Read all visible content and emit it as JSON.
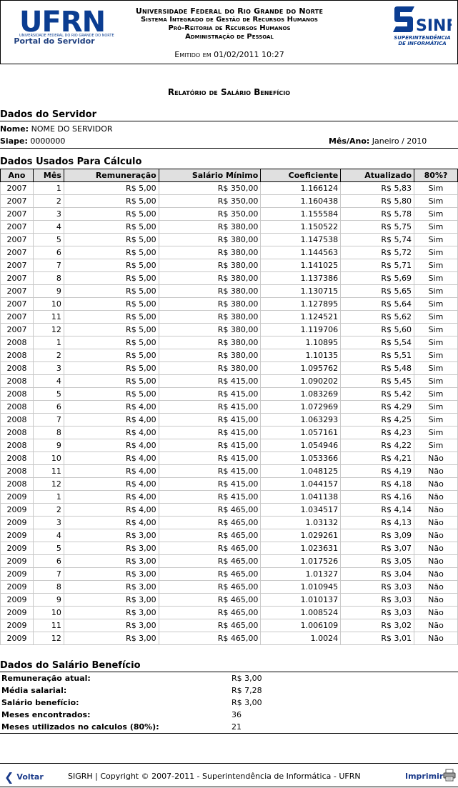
{
  "header": {
    "logo_text": "UFRN",
    "logo_subtext": "UNIVERSIDADE FEDERAL DO RIO GRANDE DO NORTE",
    "portal": "Portal do Servidor",
    "line1": "Universidade Federal do Rio Grande do Norte",
    "line2": "Sistema Integrado de Gestão de Recursos Humanos",
    "line3": "Pró-Reitoria de Recursos Humanos",
    "line4": "Administração de Pessoal",
    "emitted": "Emitido em 01/02/2011 10:27",
    "sinfo_logo": "SINFO",
    "sinfo_line1": "SUPERINTENDÊNCIA",
    "sinfo_line2": "DE INFORMÁTICA",
    "colors": {
      "brand_blue": "#0b3d91",
      "header_bg": "#e0e0e0"
    }
  },
  "report_title": "Relatório de Salário Benefício",
  "servidor": {
    "section_title": "Dados do Servidor",
    "nome_label": "Nome:",
    "nome_value": "NOME DO SERVIDOR",
    "siape_label": "Siape:",
    "siape_value": "0000000",
    "mesano_label": "Mês/Ano:",
    "mesano_value": "Janeiro / 2010"
  },
  "calc": {
    "section_title": "Dados Usados Para Cálculo",
    "headers": [
      "Ano",
      "Mês",
      "Remuneração",
      "Salário Mínimo",
      "Coeficiente",
      "Atualizado",
      "80%?"
    ],
    "rows": [
      [
        "2007",
        "1",
        "R$ 5,00",
        "R$ 350,00",
        "1.166124",
        "R$ 5,83",
        "Sim"
      ],
      [
        "2007",
        "2",
        "R$ 5,00",
        "R$ 350,00",
        "1.160438",
        "R$ 5,80",
        "Sim"
      ],
      [
        "2007",
        "3",
        "R$ 5,00",
        "R$ 350,00",
        "1.155584",
        "R$ 5,78",
        "Sim"
      ],
      [
        "2007",
        "4",
        "R$ 5,00",
        "R$ 380,00",
        "1.150522",
        "R$ 5,75",
        "Sim"
      ],
      [
        "2007",
        "5",
        "R$ 5,00",
        "R$ 380,00",
        "1.147538",
        "R$ 5,74",
        "Sim"
      ],
      [
        "2007",
        "6",
        "R$ 5,00",
        "R$ 380,00",
        "1.144563",
        "R$ 5,72",
        "Sim"
      ],
      [
        "2007",
        "7",
        "R$ 5,00",
        "R$ 380,00",
        "1.141025",
        "R$ 5,71",
        "Sim"
      ],
      [
        "2007",
        "8",
        "R$ 5,00",
        "R$ 380,00",
        "1.137386",
        "R$ 5,69",
        "Sim"
      ],
      [
        "2007",
        "9",
        "R$ 5,00",
        "R$ 380,00",
        "1.130715",
        "R$ 5,65",
        "Sim"
      ],
      [
        "2007",
        "10",
        "R$ 5,00",
        "R$ 380,00",
        "1.127895",
        "R$ 5,64",
        "Sim"
      ],
      [
        "2007",
        "11",
        "R$ 5,00",
        "R$ 380,00",
        "1.124521",
        "R$ 5,62",
        "Sim"
      ],
      [
        "2007",
        "12",
        "R$ 5,00",
        "R$ 380,00",
        "1.119706",
        "R$ 5,60",
        "Sim"
      ],
      [
        "2008",
        "1",
        "R$ 5,00",
        "R$ 380,00",
        "1.10895",
        "R$ 5,54",
        "Sim"
      ],
      [
        "2008",
        "2",
        "R$ 5,00",
        "R$ 380,00",
        "1.10135",
        "R$ 5,51",
        "Sim"
      ],
      [
        "2008",
        "3",
        "R$ 5,00",
        "R$ 380,00",
        "1.095762",
        "R$ 5,48",
        "Sim"
      ],
      [
        "2008",
        "4",
        "R$ 5,00",
        "R$ 415,00",
        "1.090202",
        "R$ 5,45",
        "Sim"
      ],
      [
        "2008",
        "5",
        "R$ 5,00",
        "R$ 415,00",
        "1.083269",
        "R$ 5,42",
        "Sim"
      ],
      [
        "2008",
        "6",
        "R$ 4,00",
        "R$ 415,00",
        "1.072969",
        "R$ 4,29",
        "Sim"
      ],
      [
        "2008",
        "7",
        "R$ 4,00",
        "R$ 415,00",
        "1.063293",
        "R$ 4,25",
        "Sim"
      ],
      [
        "2008",
        "8",
        "R$ 4,00",
        "R$ 415,00",
        "1.057161",
        "R$ 4,23",
        "Sim"
      ],
      [
        "2008",
        "9",
        "R$ 4,00",
        "R$ 415,00",
        "1.054946",
        "R$ 4,22",
        "Sim"
      ],
      [
        "2008",
        "10",
        "R$ 4,00",
        "R$ 415,00",
        "1.053366",
        "R$ 4,21",
        "Não"
      ],
      [
        "2008",
        "11",
        "R$ 4,00",
        "R$ 415,00",
        "1.048125",
        "R$ 4,19",
        "Não"
      ],
      [
        "2008",
        "12",
        "R$ 4,00",
        "R$ 415,00",
        "1.044157",
        "R$ 4,18",
        "Não"
      ],
      [
        "2009",
        "1",
        "R$ 4,00",
        "R$ 415,00",
        "1.041138",
        "R$ 4,16",
        "Não"
      ],
      [
        "2009",
        "2",
        "R$ 4,00",
        "R$ 465,00",
        "1.034517",
        "R$ 4,14",
        "Não"
      ],
      [
        "2009",
        "3",
        "R$ 4,00",
        "R$ 465,00",
        "1.03132",
        "R$ 4,13",
        "Não"
      ],
      [
        "2009",
        "4",
        "R$ 3,00",
        "R$ 465,00",
        "1.029261",
        "R$ 3,09",
        "Não"
      ],
      [
        "2009",
        "5",
        "R$ 3,00",
        "R$ 465,00",
        "1.023631",
        "R$ 3,07",
        "Não"
      ],
      [
        "2009",
        "6",
        "R$ 3,00",
        "R$ 465,00",
        "1.017526",
        "R$ 3,05",
        "Não"
      ],
      [
        "2009",
        "7",
        "R$ 3,00",
        "R$ 465,00",
        "1.01327",
        "R$ 3,04",
        "Não"
      ],
      [
        "2009",
        "8",
        "R$ 3,00",
        "R$ 465,00",
        "1.010945",
        "R$ 3,03",
        "Não"
      ],
      [
        "2009",
        "9",
        "R$ 3,00",
        "R$ 465,00",
        "1.010137",
        "R$ 3,03",
        "Não"
      ],
      [
        "2009",
        "10",
        "R$ 3,00",
        "R$ 465,00",
        "1.008524",
        "R$ 3,03",
        "Não"
      ],
      [
        "2009",
        "11",
        "R$ 3,00",
        "R$ 465,00",
        "1.006109",
        "R$ 3,02",
        "Não"
      ],
      [
        "2009",
        "12",
        "R$ 3,00",
        "R$ 465,00",
        "1.0024",
        "R$ 3,01",
        "Não"
      ]
    ]
  },
  "beneficio": {
    "section_title": "Dados do Salário Benefício",
    "items": [
      {
        "label": "Remuneração atual:",
        "value": "R$ 3,00"
      },
      {
        "label": "Média salarial:",
        "value": "R$ 7,28"
      },
      {
        "label": "Salário benefício:",
        "value": "R$ 3,00"
      },
      {
        "label": "Meses encontrados:",
        "value": "36"
      },
      {
        "label": "Meses utilizados no calculos (80%):",
        "value": "21"
      }
    ]
  },
  "footer": {
    "voltar_label": "Voltar",
    "copyright": "SIGRH | Copyright © 2007-2011 - Superintendência de Informática - UFRN",
    "imprimir_label": "Imprimir",
    "icons": {
      "back": "back-arrow-icon",
      "print": "printer-icon"
    }
  }
}
